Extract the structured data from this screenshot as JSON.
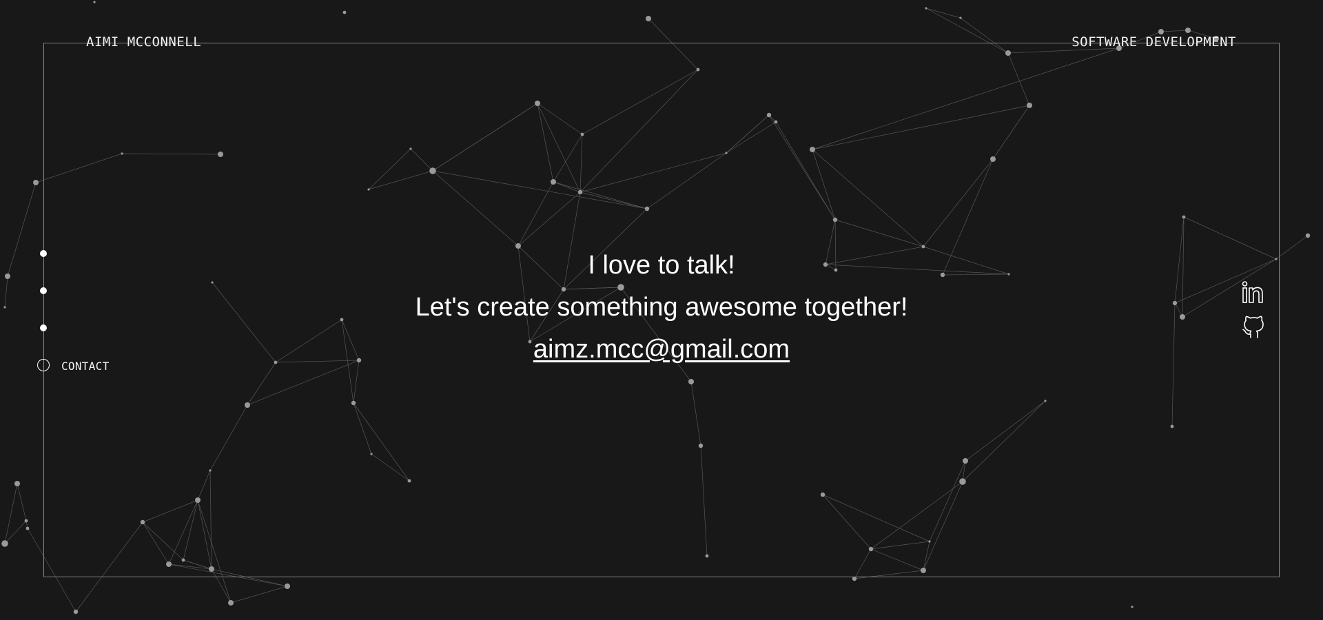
{
  "header": {
    "brand": "AIMI MCCONNELL",
    "tagline": "SOFTWARE DEVELOPMENT"
  },
  "nav": {
    "sections": [
      {
        "label": "",
        "active": false
      },
      {
        "label": "",
        "active": false
      },
      {
        "label": "",
        "active": false
      },
      {
        "label": "CONTACT",
        "active": true
      }
    ],
    "active_label": "CONTACT"
  },
  "hero": {
    "line1": "I love to talk!",
    "line2": "Let's create something awesome together!",
    "email": "aimz.mcc@gmail.com"
  },
  "social": [
    {
      "icon": "linkedin-icon"
    },
    {
      "icon": "github-icon"
    }
  ],
  "colors": {
    "background": "#181818",
    "text": "#ffffff",
    "frame": "#8a8a8a",
    "network": "#8a8a8a"
  }
}
